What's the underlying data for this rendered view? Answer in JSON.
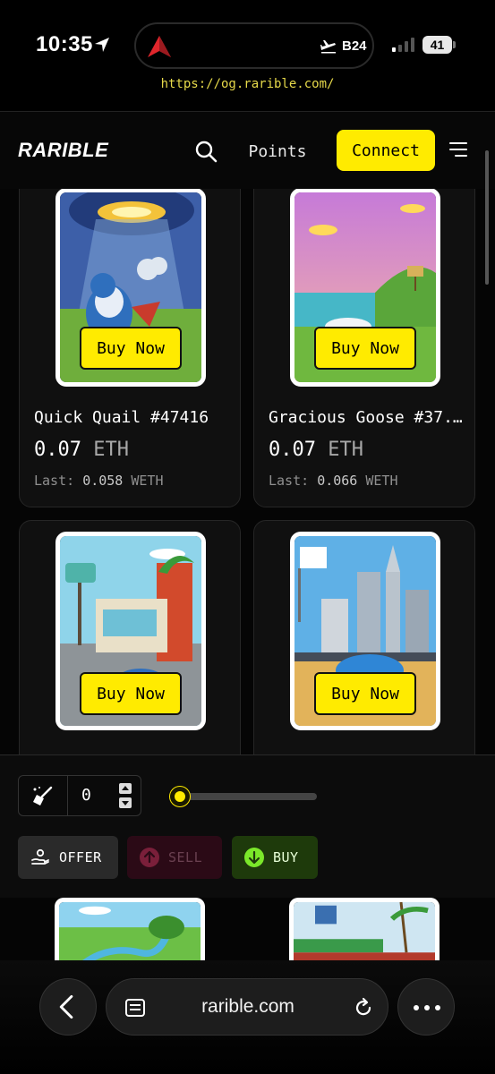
{
  "status_bar": {
    "time": "10:35",
    "flight_code": "B24",
    "battery": "41",
    "url_hint": "https://og.rarible.com/"
  },
  "header": {
    "logo": "RARIBLE",
    "points_label": "Points",
    "connect_label": "Connect"
  },
  "listings": [
    {
      "name": "Quick Quail #47416",
      "price": "0.07",
      "unit": "ETH",
      "last_label": "Last:",
      "last_value": "0.058",
      "last_unit": "WETH",
      "buy_label": "Buy Now"
    },
    {
      "name": "Gracious Goose #37...",
      "price": "0.07",
      "unit": "ETH",
      "last_label": "Last:",
      "last_value": "0.066",
      "last_unit": "WETH",
      "buy_label": "Buy Now"
    },
    {
      "name": "",
      "price": "",
      "unit": "",
      "last_label": "",
      "last_value": "",
      "last_unit": "",
      "buy_label": "Buy Now"
    },
    {
      "name": "",
      "price": "",
      "unit": "",
      "last_label": "",
      "last_value": "",
      "last_unit": "",
      "buy_label": "Buy Now"
    }
  ],
  "toolbar": {
    "sweep_count": "0",
    "slider_fraction": 0,
    "offer_label": "OFFER",
    "sell_label": "SELL",
    "buy_label": "BUY"
  },
  "browser": {
    "address": "rarible.com"
  },
  "colors": {
    "accent": "#ffeb00",
    "sell": "#2b0a16",
    "buy": "#1e3a0b"
  }
}
